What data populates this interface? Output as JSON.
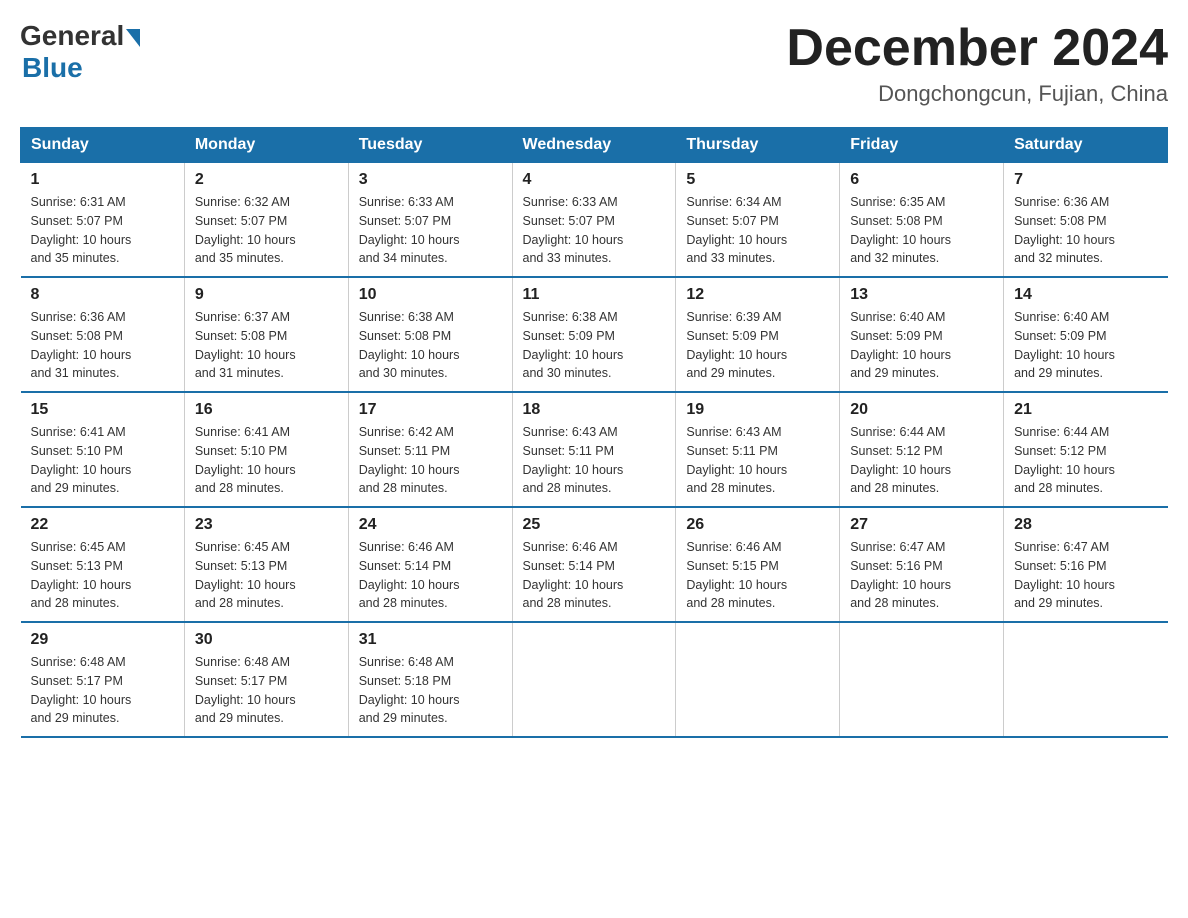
{
  "header": {
    "logo_general": "General",
    "logo_blue": "Blue",
    "month_title": "December 2024",
    "location": "Dongchongcun, Fujian, China"
  },
  "days_of_week": [
    "Sunday",
    "Monday",
    "Tuesday",
    "Wednesday",
    "Thursday",
    "Friday",
    "Saturday"
  ],
  "weeks": [
    [
      {
        "day": "1",
        "sunrise": "6:31 AM",
        "sunset": "5:07 PM",
        "daylight": "10 hours and 35 minutes."
      },
      {
        "day": "2",
        "sunrise": "6:32 AM",
        "sunset": "5:07 PM",
        "daylight": "10 hours and 35 minutes."
      },
      {
        "day": "3",
        "sunrise": "6:33 AM",
        "sunset": "5:07 PM",
        "daylight": "10 hours and 34 minutes."
      },
      {
        "day": "4",
        "sunrise": "6:33 AM",
        "sunset": "5:07 PM",
        "daylight": "10 hours and 33 minutes."
      },
      {
        "day": "5",
        "sunrise": "6:34 AM",
        "sunset": "5:07 PM",
        "daylight": "10 hours and 33 minutes."
      },
      {
        "day": "6",
        "sunrise": "6:35 AM",
        "sunset": "5:08 PM",
        "daylight": "10 hours and 32 minutes."
      },
      {
        "day": "7",
        "sunrise": "6:36 AM",
        "sunset": "5:08 PM",
        "daylight": "10 hours and 32 minutes."
      }
    ],
    [
      {
        "day": "8",
        "sunrise": "6:36 AM",
        "sunset": "5:08 PM",
        "daylight": "10 hours and 31 minutes."
      },
      {
        "day": "9",
        "sunrise": "6:37 AM",
        "sunset": "5:08 PM",
        "daylight": "10 hours and 31 minutes."
      },
      {
        "day": "10",
        "sunrise": "6:38 AM",
        "sunset": "5:08 PM",
        "daylight": "10 hours and 30 minutes."
      },
      {
        "day": "11",
        "sunrise": "6:38 AM",
        "sunset": "5:09 PM",
        "daylight": "10 hours and 30 minutes."
      },
      {
        "day": "12",
        "sunrise": "6:39 AM",
        "sunset": "5:09 PM",
        "daylight": "10 hours and 29 minutes."
      },
      {
        "day": "13",
        "sunrise": "6:40 AM",
        "sunset": "5:09 PM",
        "daylight": "10 hours and 29 minutes."
      },
      {
        "day": "14",
        "sunrise": "6:40 AM",
        "sunset": "5:09 PM",
        "daylight": "10 hours and 29 minutes."
      }
    ],
    [
      {
        "day": "15",
        "sunrise": "6:41 AM",
        "sunset": "5:10 PM",
        "daylight": "10 hours and 29 minutes."
      },
      {
        "day": "16",
        "sunrise": "6:41 AM",
        "sunset": "5:10 PM",
        "daylight": "10 hours and 28 minutes."
      },
      {
        "day": "17",
        "sunrise": "6:42 AM",
        "sunset": "5:11 PM",
        "daylight": "10 hours and 28 minutes."
      },
      {
        "day": "18",
        "sunrise": "6:43 AM",
        "sunset": "5:11 PM",
        "daylight": "10 hours and 28 minutes."
      },
      {
        "day": "19",
        "sunrise": "6:43 AM",
        "sunset": "5:11 PM",
        "daylight": "10 hours and 28 minutes."
      },
      {
        "day": "20",
        "sunrise": "6:44 AM",
        "sunset": "5:12 PM",
        "daylight": "10 hours and 28 minutes."
      },
      {
        "day": "21",
        "sunrise": "6:44 AM",
        "sunset": "5:12 PM",
        "daylight": "10 hours and 28 minutes."
      }
    ],
    [
      {
        "day": "22",
        "sunrise": "6:45 AM",
        "sunset": "5:13 PM",
        "daylight": "10 hours and 28 minutes."
      },
      {
        "day": "23",
        "sunrise": "6:45 AM",
        "sunset": "5:13 PM",
        "daylight": "10 hours and 28 minutes."
      },
      {
        "day": "24",
        "sunrise": "6:46 AM",
        "sunset": "5:14 PM",
        "daylight": "10 hours and 28 minutes."
      },
      {
        "day": "25",
        "sunrise": "6:46 AM",
        "sunset": "5:14 PM",
        "daylight": "10 hours and 28 minutes."
      },
      {
        "day": "26",
        "sunrise": "6:46 AM",
        "sunset": "5:15 PM",
        "daylight": "10 hours and 28 minutes."
      },
      {
        "day": "27",
        "sunrise": "6:47 AM",
        "sunset": "5:16 PM",
        "daylight": "10 hours and 28 minutes."
      },
      {
        "day": "28",
        "sunrise": "6:47 AM",
        "sunset": "5:16 PM",
        "daylight": "10 hours and 29 minutes."
      }
    ],
    [
      {
        "day": "29",
        "sunrise": "6:48 AM",
        "sunset": "5:17 PM",
        "daylight": "10 hours and 29 minutes."
      },
      {
        "day": "30",
        "sunrise": "6:48 AM",
        "sunset": "5:17 PM",
        "daylight": "10 hours and 29 minutes."
      },
      {
        "day": "31",
        "sunrise": "6:48 AM",
        "sunset": "5:18 PM",
        "daylight": "10 hours and 29 minutes."
      },
      null,
      null,
      null,
      null
    ]
  ],
  "labels": {
    "sunrise": "Sunrise:",
    "sunset": "Sunset:",
    "daylight": "Daylight:"
  }
}
